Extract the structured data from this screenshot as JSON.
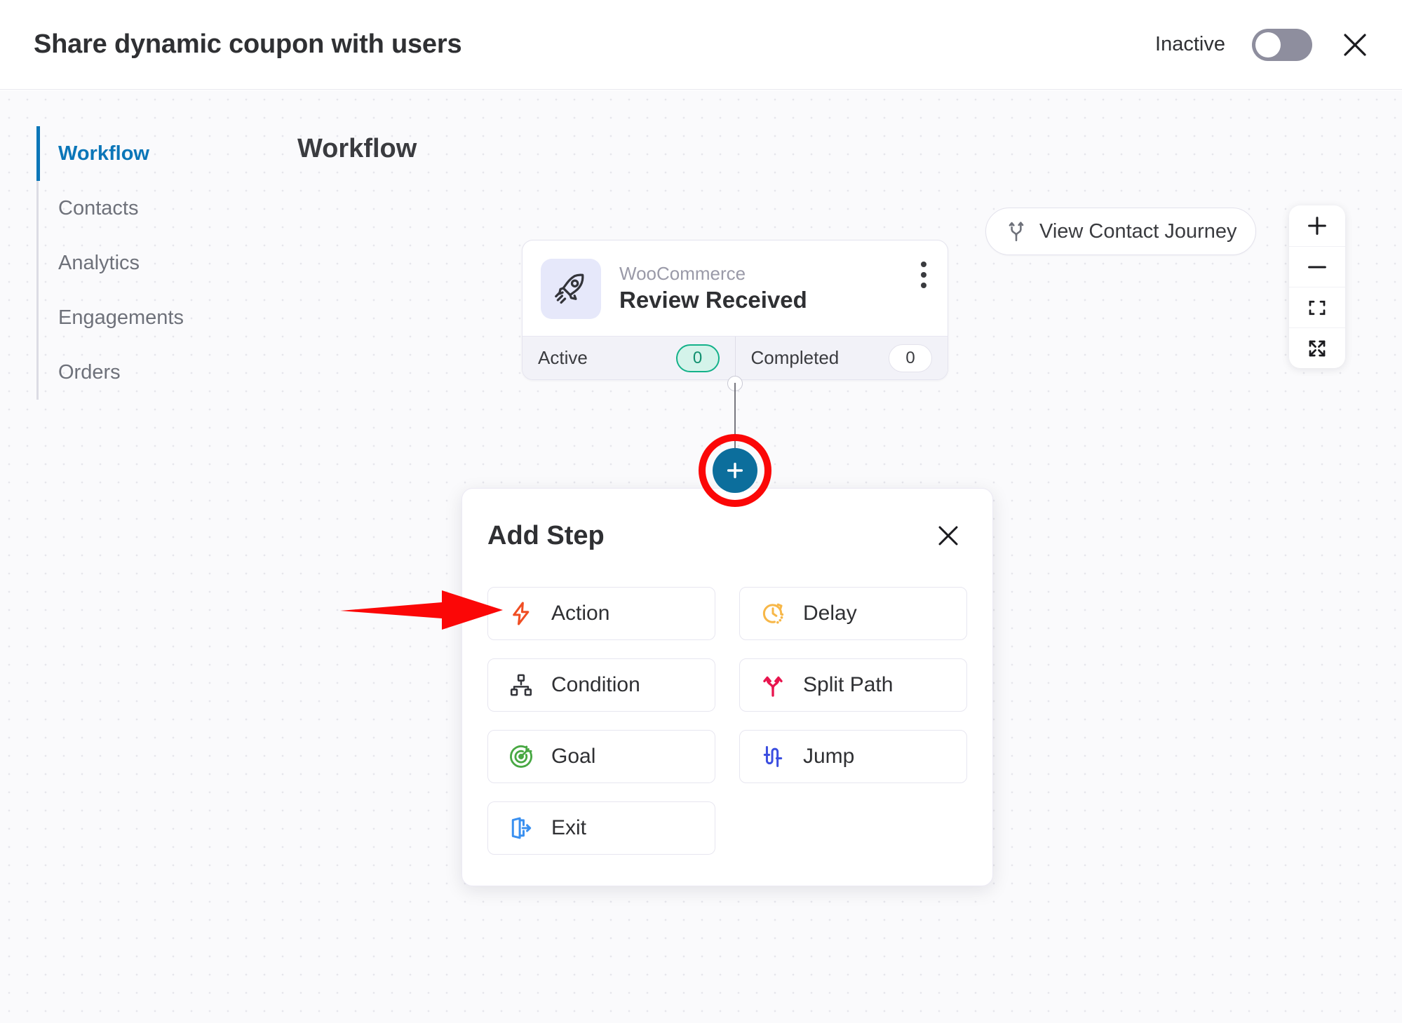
{
  "header": {
    "title": "Share dynamic coupon with users",
    "status_label": "Inactive",
    "toggle_state": "off",
    "close_icon": "close-icon"
  },
  "sidebar": {
    "items": [
      {
        "label": "Workflow",
        "active": true
      },
      {
        "label": "Contacts",
        "active": false
      },
      {
        "label": "Analytics",
        "active": false
      },
      {
        "label": "Engagements",
        "active": false
      },
      {
        "label": "Orders",
        "active": false
      }
    ]
  },
  "canvas": {
    "title": "Workflow",
    "view_journey_button": "View Contact Journey",
    "zoom_controls": [
      {
        "name": "zoom-in-icon"
      },
      {
        "name": "zoom-out-icon"
      },
      {
        "name": "fit-view-icon"
      },
      {
        "name": "fullscreen-icon"
      }
    ]
  },
  "trigger_card": {
    "icon": "rocket-icon",
    "source": "WooCommerce",
    "name": "Review Received",
    "stats": [
      {
        "label": "Active",
        "value": "0",
        "style": "active"
      },
      {
        "label": "Completed",
        "value": "0",
        "style": "completed"
      }
    ],
    "menu_icon": "more-vertical-icon"
  },
  "add_step_panel": {
    "title": "Add Step",
    "close_icon": "close-icon",
    "options": [
      {
        "label": "Action",
        "icon": "lightning-bolt-icon",
        "color": "#f04e23"
      },
      {
        "label": "Delay",
        "icon": "clock-icon",
        "color": "#f7b748"
      },
      {
        "label": "Condition",
        "icon": "hierarchy-icon",
        "color": "#33343a"
      },
      {
        "label": "Split Path",
        "icon": "split-path-icon",
        "color": "#e8154e"
      },
      {
        "label": "Goal",
        "icon": "target-icon",
        "color": "#48a843"
      },
      {
        "label": "Jump",
        "icon": "jump-icon",
        "color": "#3b4ee0"
      },
      {
        "label": "Exit",
        "icon": "exit-door-icon",
        "color": "#3a90f0"
      }
    ]
  },
  "annotations": {
    "highlight_ring": "red-circle-highlight",
    "pointer_arrow": "red-arrow-pointing-to-action"
  },
  "colors": {
    "accent_blue": "#0b76b8",
    "node_blue": "#0c6e9c",
    "annotation_red": "#fb0707",
    "active_pill_green": "#13b189",
    "canvas_bg": "#fafafc"
  }
}
